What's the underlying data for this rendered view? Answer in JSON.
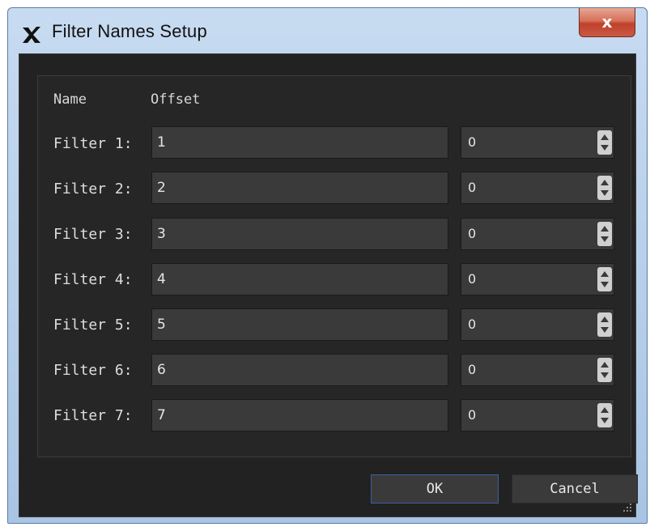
{
  "window": {
    "title": "Filter Names Setup",
    "close_label": "x"
  },
  "headers": {
    "name": "Name",
    "offset": "Offset"
  },
  "filters": [
    {
      "label": "Filter 1:",
      "name": "1",
      "offset": "0"
    },
    {
      "label": "Filter 2:",
      "name": "2",
      "offset": "0"
    },
    {
      "label": "Filter 3:",
      "name": "3",
      "offset": "0"
    },
    {
      "label": "Filter 4:",
      "name": "4",
      "offset": "0"
    },
    {
      "label": "Filter 5:",
      "name": "5",
      "offset": "0"
    },
    {
      "label": "Filter 6:",
      "name": "6",
      "offset": "0"
    },
    {
      "label": "Filter 7:",
      "name": "7",
      "offset": "0"
    }
  ],
  "buttons": {
    "ok": "OK",
    "cancel": "Cancel"
  },
  "icons": {
    "app": "app-x-logo-icon",
    "close": "close-icon",
    "spin": "spin-arrows-icon",
    "grip": "resize-grip-icon"
  },
  "colors": {
    "background": "#222222",
    "field": "#3a3a3a",
    "ok_border": "#3d5fa0",
    "close_button": "#c0412b"
  }
}
